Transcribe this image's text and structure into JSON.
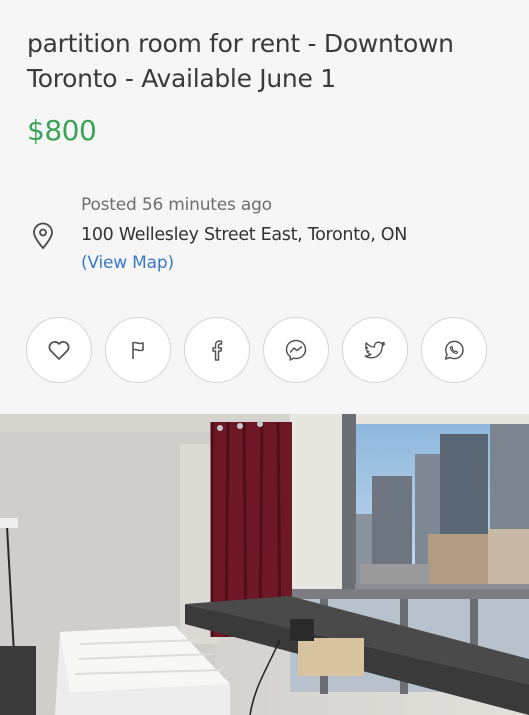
{
  "listing": {
    "title": "partition room for rent - Downtown Toronto - Available June 1",
    "price": "$800",
    "posted": "Posted 56 minutes ago",
    "address": "100 Wellesley Street East, Toronto, ON",
    "view_map": "(View Map)"
  },
  "icons": {
    "location": "map-pin-icon",
    "favorite": "heart-icon",
    "report": "flag-icon",
    "facebook": "facebook-icon",
    "messenger": "messenger-icon",
    "twitter": "twitter-icon",
    "whatsapp": "whatsapp-icon"
  },
  "colors": {
    "price": "#3aa357",
    "link": "#3a78c8",
    "background": "#f6f6f6",
    "icon_stroke": "#555555"
  }
}
